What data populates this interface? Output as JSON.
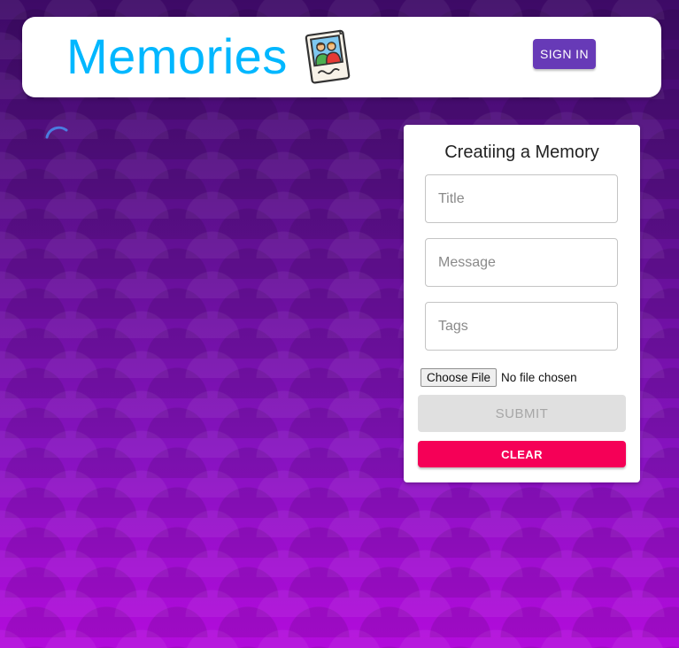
{
  "appbar": {
    "title": "Memories",
    "logo_icon": "photo-memories-icon",
    "signin_label": "SIGN IN",
    "signin_color": "#673ab7",
    "brand_color": "#00b7ff"
  },
  "loading": {
    "icon": "loading-spinner-icon"
  },
  "form": {
    "heading": "Creatiing a Memory",
    "fields": {
      "title": {
        "placeholder": "Title",
        "value": ""
      },
      "message": {
        "placeholder": "Message",
        "value": ""
      },
      "tags": {
        "placeholder": "Tags",
        "value": ""
      }
    },
    "file": {
      "button_label": "Choose File",
      "status": "No file chosen"
    },
    "submit_label": "SUBMIT",
    "clear_label": "CLEAR",
    "clear_color": "#f50057"
  }
}
